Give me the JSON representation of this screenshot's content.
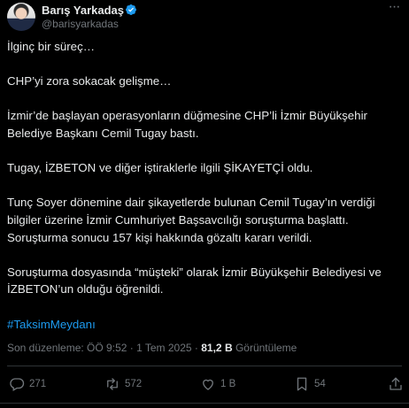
{
  "author": {
    "name": "Barış Yarkadaş",
    "handle": "@barisyarkadas",
    "verified": true
  },
  "tweet": {
    "paragraphs": [
      "İlginç bir süreç…",
      "CHP’yi zora sokacak gelişme…",
      "İzmir’de başlayan operasyonların düğmesine CHP’li İzmir Büyükşehir Belediye Başkanı Cemil Tugay bastı.",
      "Tugay, İZBETON ve diğer iştiraklerle ilgili ŞİKAYETÇİ oldu.",
      "Tunç Soyer dönemine dair şikayetlerde bulunan Cemil Tugay’ın verdiği bilgiler üzerine İzmir Cumhuriyet Başsavcılığı soruşturma başlattı. Soruşturma sonucu 157 kişi hakkında gözaltı kararı verildi.",
      "Soruşturma dosyasında “müşteki” olarak İzmir Büyükşehir Belediyesi ve İZBETON’un olduğu öğrenildi."
    ],
    "hashtag": "#TaksimMeydanı"
  },
  "meta": {
    "edited_label": "Son düzenleme: ÖÖ 9:52 · 1 Tem 2025 ·",
    "views_count": "81,2 B",
    "views_label": "Görüntüleme"
  },
  "actions": {
    "replies": "271",
    "reposts": "572",
    "likes": "1 B",
    "bookmarks": "54"
  },
  "colors": {
    "background": "#000000",
    "text": "#e7e9ea",
    "muted": "#71767b",
    "accent": "#1d9bf0",
    "divider": "#2f3336"
  },
  "icons": [
    "verified-badge-icon",
    "more-icon",
    "reply-icon",
    "repost-icon",
    "like-icon",
    "bookmark-icon",
    "share-icon"
  ]
}
